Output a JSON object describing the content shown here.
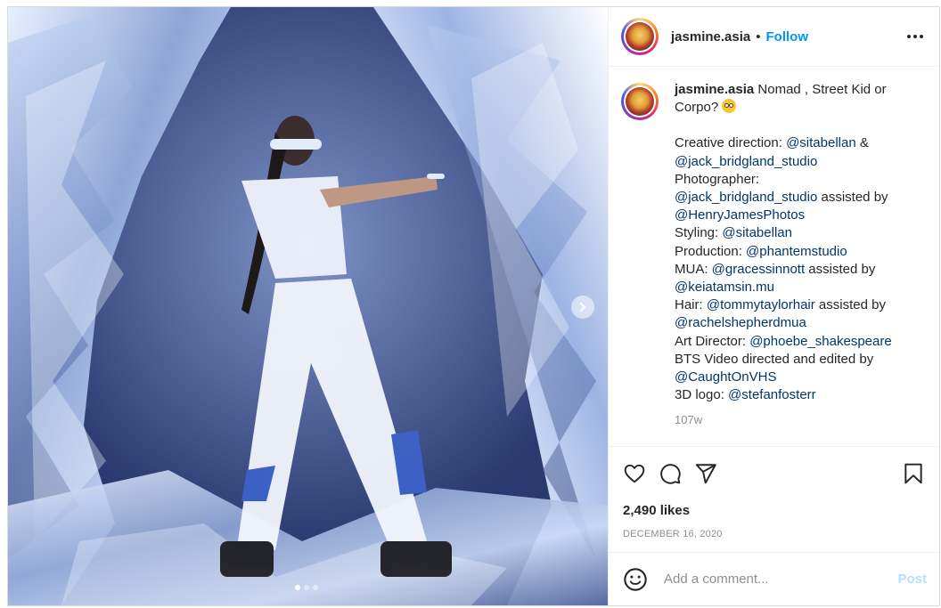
{
  "post": {
    "author": "jasmine.asia",
    "separator": "•",
    "follow_label": "Follow",
    "more_icon": "more-horizontal-icon",
    "caption": {
      "username": "jasmine.asia",
      "text_start": "Nomad , Street Kid or Corpo?",
      "emoji": "face-with-rolling-eyes-emoji",
      "credits": [
        {
          "prefix": "Creative direction: ",
          "mention": "@sitabellan",
          "suffix": " &"
        },
        {
          "prefix": "",
          "mention": "@jack_bridgland_studio",
          "suffix": ""
        },
        {
          "prefix": "Photographer:",
          "mention": "",
          "suffix": ""
        },
        {
          "prefix": "",
          "mention": "@jack_bridgland_studio",
          "suffix": " assisted by"
        },
        {
          "prefix": "",
          "mention": "@HenryJamesPhotos",
          "suffix": ""
        },
        {
          "prefix": "Styling: ",
          "mention": "@sitabellan",
          "suffix": ""
        },
        {
          "prefix": "Production: ",
          "mention": "@phantemstudio",
          "suffix": ""
        },
        {
          "prefix": "MUA: ",
          "mention": "@gracessinnott",
          "suffix": " assisted by"
        },
        {
          "prefix": "",
          "mention": "@keiatamsin.mu",
          "suffix": ""
        },
        {
          "prefix": "Hair: ",
          "mention": "@tommytaylorhair",
          "suffix": " assisted by"
        },
        {
          "prefix": "",
          "mention": "@rachelshepherdmua",
          "suffix": ""
        },
        {
          "prefix": "Art Director: ",
          "mention": "@phoebe_shakespeare",
          "suffix": ""
        },
        {
          "prefix": "BTS Video directed and edited by",
          "mention": "",
          "suffix": ""
        },
        {
          "prefix": "",
          "mention": "@CaughtOnVHS",
          "suffix": ""
        },
        {
          "prefix": "3D logo: ",
          "mention": "@stefanfosterr",
          "suffix": ""
        }
      ],
      "age": "107w"
    },
    "likes": "2,490 likes",
    "date": "DECEMBER 16, 2020",
    "comment_placeholder": "Add a comment...",
    "post_button": "Post",
    "carousel": {
      "count": 3,
      "active": 0
    }
  },
  "colors": {
    "link": "#0095f6",
    "mention": "#00376b",
    "muted": "#8e8e8e",
    "post_disabled": "#b2dffc"
  },
  "icons": {
    "like": "heart-icon",
    "comment": "comment-bubble-icon",
    "share": "paper-plane-icon",
    "save": "bookmark-icon",
    "emoji": "smiley-icon",
    "next": "chevron-right-icon"
  }
}
